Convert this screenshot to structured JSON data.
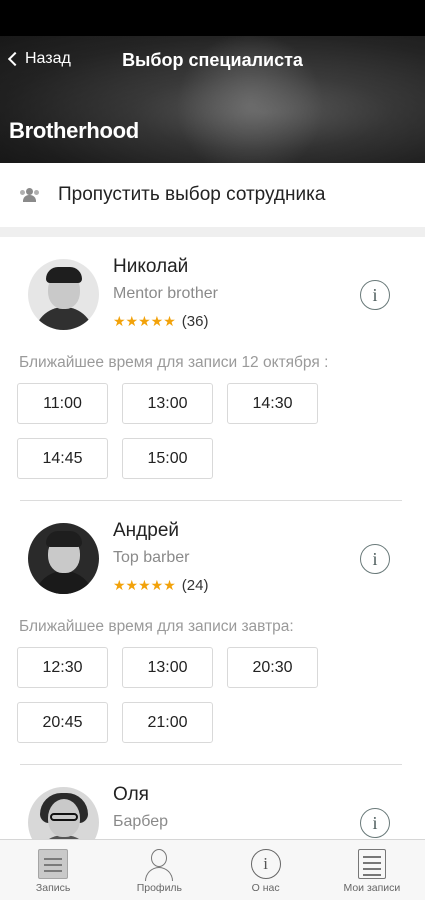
{
  "header": {
    "back_label": "Назад",
    "title": "Выбор специалиста",
    "brand": "Brotherhood"
  },
  "skip": {
    "label": "Пропустить выбор сотрудника",
    "icon": "group-icon"
  },
  "specialists": [
    {
      "name": "Николай",
      "role": "Mentor brother",
      "stars": "★★★★★",
      "reviews": "(36)",
      "nearest": "Ближайшее время для записи 12 октября :",
      "slots": [
        "11:00",
        "13:00",
        "14:30",
        "14:45",
        "15:00"
      ]
    },
    {
      "name": "Андрей",
      "role": "Top barber",
      "stars": "★★★★★",
      "reviews": "(24)",
      "nearest": "Ближайшее время для записи завтра:",
      "slots": [
        "12:30",
        "13:00",
        "20:30",
        "20:45",
        "21:00"
      ]
    },
    {
      "name": "Оля",
      "role": "Барбер"
    }
  ],
  "info_glyph": "i",
  "colors": {
    "star": "#f2a20a",
    "header_bg": "#2b2b2b",
    "slot_border": "#d9d9d9"
  },
  "tabbar": {
    "items": [
      {
        "label": "Запись",
        "icon": "calendar-list-icon"
      },
      {
        "label": "Профиль",
        "icon": "profile-icon"
      },
      {
        "label": "О нас",
        "icon": "info-icon"
      },
      {
        "label": "Мои записи",
        "icon": "my-records-icon"
      }
    ]
  }
}
